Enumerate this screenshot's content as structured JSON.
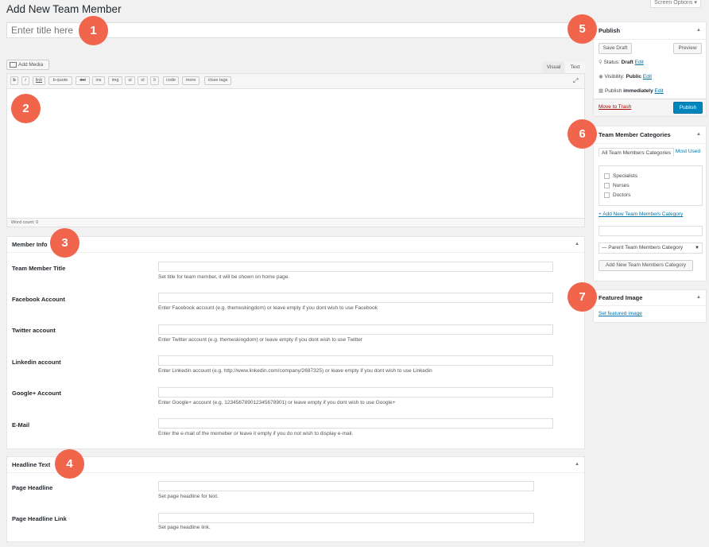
{
  "page": {
    "title": "Add New Team Member",
    "screen_options": "Screen Options ▾"
  },
  "title_field": {
    "placeholder": "Enter title here"
  },
  "badges": [
    "1",
    "2",
    "3",
    "4",
    "5",
    "6",
    "7"
  ],
  "editor": {
    "add_media": "Add Media",
    "tab_visual": "Visual",
    "tab_text": "Text",
    "quicktags": [
      "b",
      "i",
      "link",
      "b-quote",
      "del",
      "ins",
      "img",
      "ul",
      "ol",
      "li",
      "code",
      "more",
      "close tags"
    ],
    "word_count": "Word count: 0"
  },
  "member_info": {
    "title": "Member Info",
    "fields": [
      {
        "label": "Team Member Title",
        "desc": "Set title for team member, it will be shown on home page."
      },
      {
        "label": "Facebook Account",
        "desc": "Enter Facebook account (e.g. themeskingdom) or leave empty if you dont wish to use Facebook"
      },
      {
        "label": "Twitter account",
        "desc": "Enter Twitter account (e.g. themeskingdom) or leave empty if you dont wish to use Twitter"
      },
      {
        "label": "Linkedin account",
        "desc": "Enter Linkedin account (e.g. http://www.linkedin.com/company/2687325) or leave empty if you dont wish to use Linkedin"
      },
      {
        "label": "Google+ Account",
        "desc": "Enter Google+ account (e.g. 1234567890123456789​01) or leave empty if you dont wish to use Google+"
      },
      {
        "label": "E-Mail",
        "desc": "Enter the e-mail of the memeber or leave it empty if you do not wish to display e-mail."
      }
    ]
  },
  "headline": {
    "title": "Headline Text",
    "fields": [
      {
        "label": "Page Headline",
        "desc": "Set page headline for text."
      },
      {
        "label": "Page Headline Link",
        "desc": "Set page headline link."
      }
    ]
  },
  "publish": {
    "title": "Publish",
    "save_draft": "Save Draft",
    "preview": "Preview",
    "status_label": "Status:",
    "status_value": "Draft",
    "visibility_label": "Visibility:",
    "visibility_value": "Public",
    "publish_label": "Publish",
    "publish_value": "immediately",
    "edit": "Edit",
    "trash": "Move to Trash",
    "publish_button": "Publish"
  },
  "categories": {
    "title": "Team Member Categories",
    "tab_all": "All Team Members Categories",
    "tab_most_used": "Most Used",
    "items": [
      "Specialists",
      "Nurses",
      "Doctors"
    ],
    "add_new_link": "+ Add New Team Members Category",
    "parent_select": "— Parent Team Members Category",
    "add_button": "Add New Team Members Category"
  },
  "featured_image": {
    "title": "Featured Image",
    "link": "Set featured image"
  },
  "colors": {
    "badge": "#f0654c",
    "primary": "#0085ba",
    "link": "#0073aa",
    "trash": "#a00"
  }
}
